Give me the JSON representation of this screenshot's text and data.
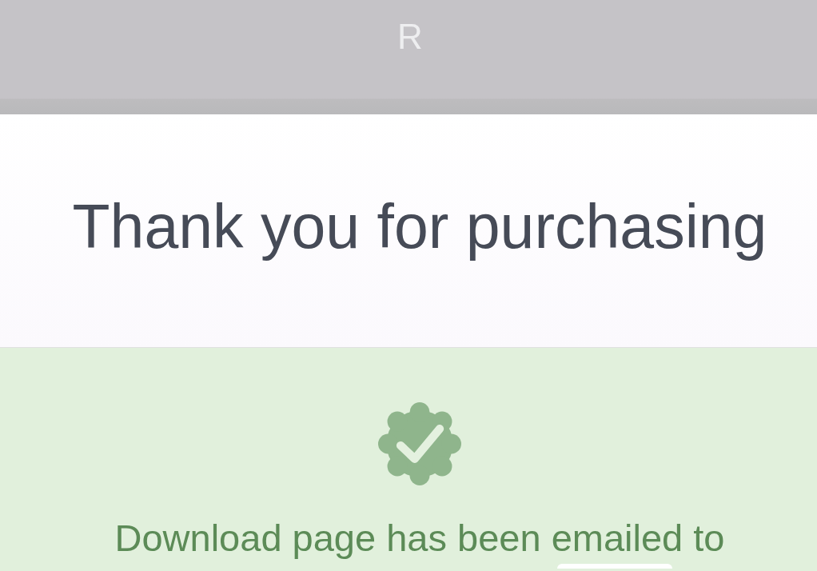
{
  "header": {
    "logo": "R"
  },
  "hero": {
    "heading": "Thank you for purchasing"
  },
  "confirmation": {
    "message": "Download page has been emailed to"
  }
}
